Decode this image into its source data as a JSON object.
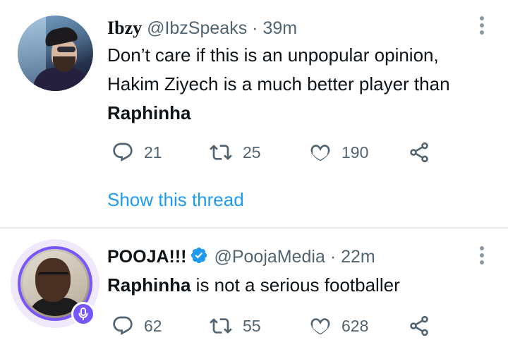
{
  "tweets": [
    {
      "display_name": "Ibzy",
      "handle": "@IbzSpeaks",
      "separator": "·",
      "time": "39m",
      "text_parts": [
        "Don’t care if this is an unpopular opinion, Hakim Ziyech is a much better player than ",
        "Raphinha"
      ],
      "counts": {
        "replies": "21",
        "retweets": "25",
        "likes": "190"
      },
      "show_thread": "Show this thread",
      "icons": [
        "more-vertical-icon",
        "reply-icon",
        "retweet-icon",
        "like-icon",
        "share-icon"
      ]
    },
    {
      "display_name": "POOJA!!!",
      "verified": true,
      "handle": "@PoojaMedia",
      "separator": "·",
      "time": "22m",
      "text_parts": [
        "Raphinha",
        " is not a serious footballer"
      ],
      "counts": {
        "replies": "62",
        "retweets": "55",
        "likes": "628"
      },
      "badge": "spaces-mic-icon",
      "icons": [
        "more-vertical-icon",
        "reply-icon",
        "retweet-icon",
        "like-icon",
        "share-icon",
        "verified-icon"
      ]
    }
  ],
  "colors": {
    "text_primary": "#0f1419",
    "text_secondary": "#536471",
    "link": "#1d9bf0",
    "verified": "#1d9bf0",
    "spaces_ring": "#7856ff",
    "divider": "#e7e9ea"
  }
}
